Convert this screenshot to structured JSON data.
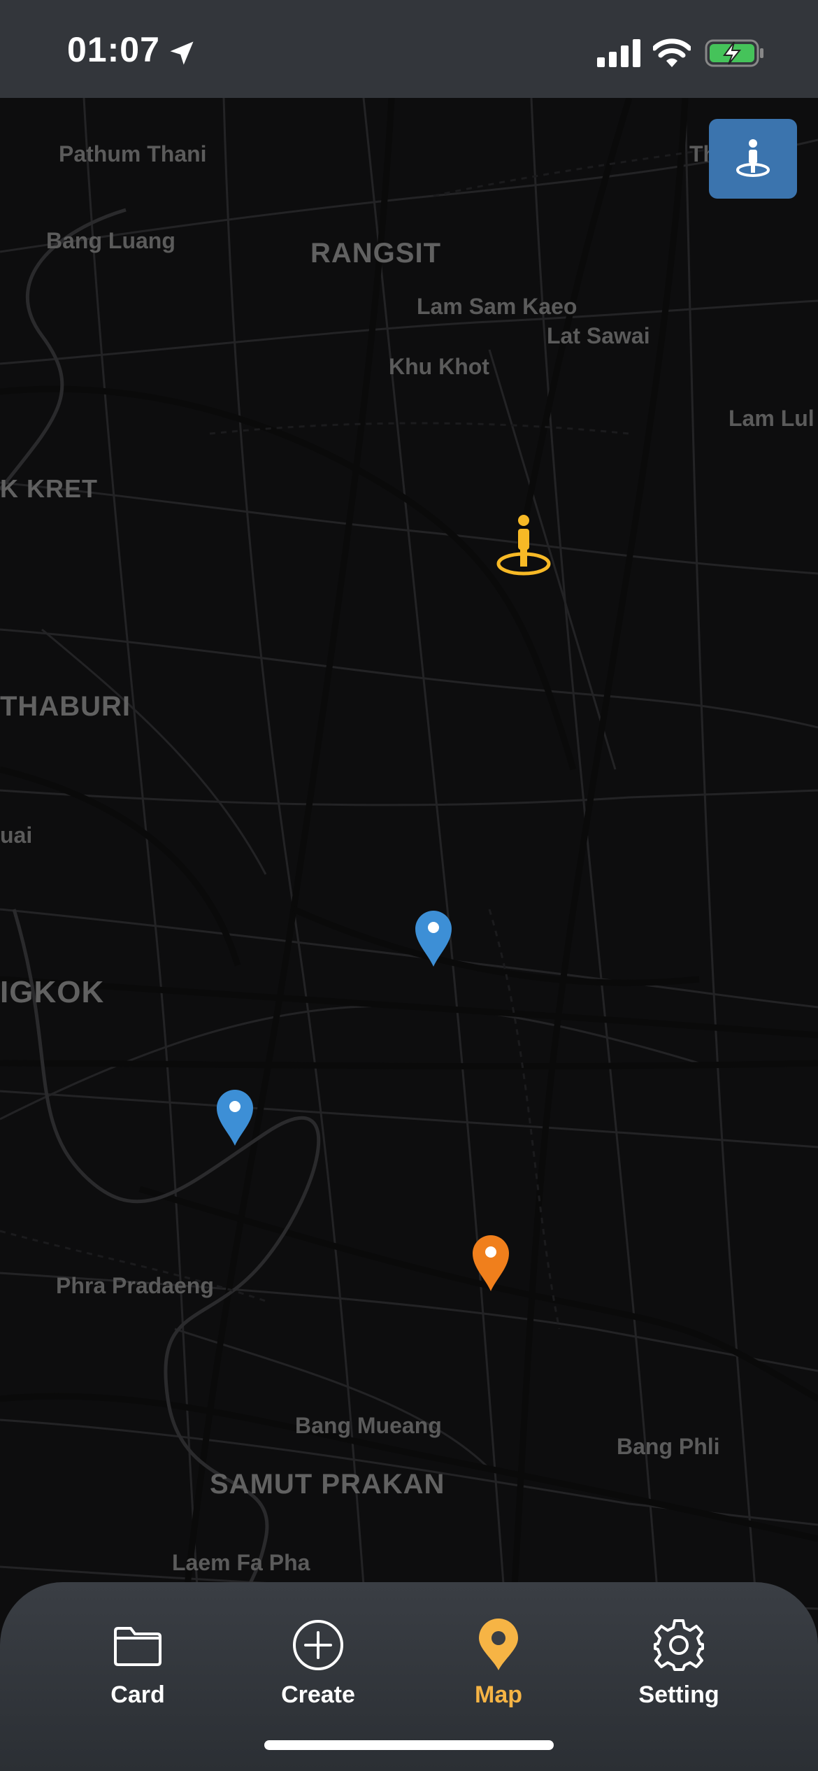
{
  "status_bar": {
    "time": "01:07"
  },
  "map": {
    "labels": {
      "pathum_thani": "Pathum Thani",
      "bang_luang": "Bang Luang",
      "rangsit": "RANGSIT",
      "thanyaburi_partial": "Th",
      "lam_sam_kaeo": "Lam Sam Kaeo",
      "lat_sawai": "Lat Sawai",
      "khu_khot": "Khu Khot",
      "lam_luk_partial": "Lam Lul",
      "pak_kret_partial": "K KRET",
      "nonthaburi_partial": "THABURI",
      "uai_partial": "uai",
      "bangkok_partial": "IGKOK",
      "phra_pradaeng": "Phra Pradaeng",
      "bang_mueang": "Bang Mueang",
      "bang_phli": "Bang Phli",
      "samut_prakan": "SAMUT PRAKAN",
      "laem_fa_pha": "Laem Fa Pha"
    },
    "pin_colors": {
      "blue": "#3d8fd6",
      "orange": "#f07f1c",
      "user": "#f7b926"
    }
  },
  "tabs": [
    {
      "label": "Card",
      "icon": "folder-icon"
    },
    {
      "label": "Create",
      "icon": "plus-circle-icon"
    },
    {
      "label": "Map",
      "icon": "map-pin-icon",
      "active": true
    },
    {
      "label": "Setting",
      "icon": "gear-icon"
    }
  ]
}
